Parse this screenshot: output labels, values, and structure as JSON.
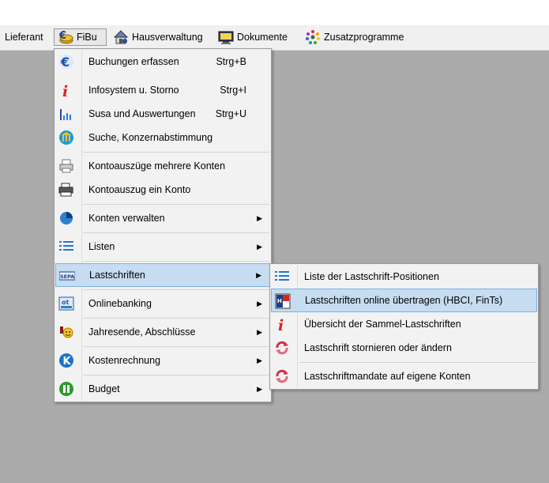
{
  "menubar": {
    "items": [
      {
        "label": "Lieferant",
        "icon": "none"
      },
      {
        "label": "FiBu",
        "icon": "euro-coins-icon"
      },
      {
        "label": "Hausverwaltung",
        "icon": "house-icon"
      },
      {
        "label": "Dokumente",
        "icon": "monitor-document-icon"
      },
      {
        "label": "Zusatzprogramme",
        "icon": "colorful-dots-icon"
      }
    ]
  },
  "fibu_menu": {
    "items": [
      {
        "label": "Buchungen erfassen",
        "shortcut": "Strg+B",
        "icon": "euro-icon"
      },
      {
        "label": "Infosystem u. Storno",
        "shortcut": "Strg+I",
        "icon": "info-icon"
      },
      {
        "label": "Susa und Auswertungen",
        "shortcut": "Strg+U",
        "icon": "bar-chart-icon"
      },
      {
        "label": "Suche, Konzernabstimmung",
        "shortcut": "",
        "icon": "bank-icon"
      },
      {
        "label": "Kontoauszüge mehrere Konten",
        "shortcut": "",
        "icon": "printer-icon"
      },
      {
        "label": "Kontoauszug ein Konto",
        "shortcut": "",
        "icon": "printer-stack-icon"
      },
      {
        "label": "Konten verwalten",
        "shortcut": "",
        "icon": "pie-icon",
        "submenu": true
      },
      {
        "label": "Listen",
        "shortcut": "",
        "icon": "list-icon",
        "submenu": true
      },
      {
        "label": "Lastschriften",
        "shortcut": "",
        "icon": "sepa-icon",
        "submenu": true,
        "highlighted": true
      },
      {
        "label": "Onlinebanking",
        "shortcut": "",
        "icon": "online-banking-icon",
        "submenu": true
      },
      {
        "label": "Jahresende, Abschlüsse",
        "shortcut": "",
        "icon": "celebration-icon",
        "submenu": true
      },
      {
        "label": "Kostenrechnung",
        "shortcut": "",
        "icon": "k-circle-icon",
        "submenu": true
      },
      {
        "label": "Budget",
        "shortcut": "",
        "icon": "budget-icon",
        "submenu": true
      }
    ]
  },
  "lastschriften_menu": {
    "items": [
      {
        "label": "Liste der Lastschrift-Positionen",
        "icon": "list-icon"
      },
      {
        "label": "Lastschriften online übertragen (HBCI, FinTs)",
        "icon": "hbci-icon",
        "highlighted": true
      },
      {
        "label": "Übersicht der Sammel-Lastschriften",
        "icon": "info-icon"
      },
      {
        "label": "Lastschrift stornieren oder ändern",
        "icon": "refresh-icon"
      },
      {
        "label": "Lastschriftmandate auf eigene Konten",
        "icon": "refresh-icon"
      }
    ]
  },
  "arrow_glyph": "▶"
}
